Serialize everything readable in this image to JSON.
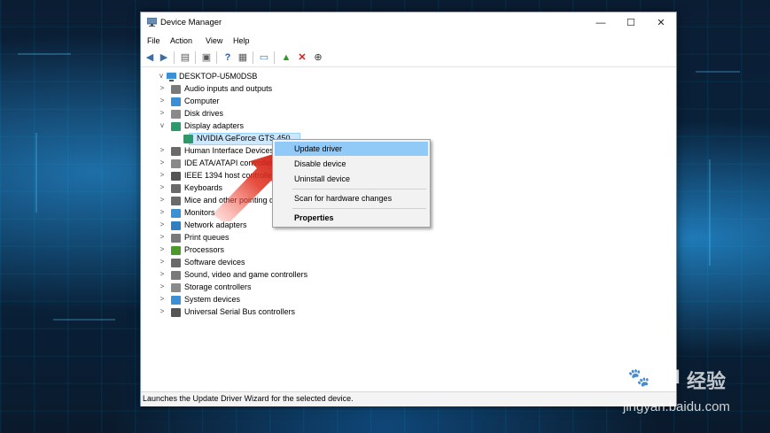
{
  "window": {
    "title": "Device Manager"
  },
  "window_buttons": [
    "—",
    "☐",
    "✕"
  ],
  "menubar": [
    "File",
    "Action",
    "View",
    "Help"
  ],
  "tree": {
    "root": "DESKTOP-U5M0DSB",
    "nodes": [
      {
        "label": "Audio inputs and outputs",
        "expand": ">",
        "icon_color": "#7a7a7a"
      },
      {
        "label": "Computer",
        "expand": ">",
        "icon_color": "#3b8fd4"
      },
      {
        "label": "Disk drives",
        "expand": ">",
        "icon_color": "#8a8a8a"
      },
      {
        "label": "Display adapters",
        "expand": "v",
        "icon_color": "#2c9a6a"
      },
      {
        "label": "NVIDIA GeForce GTS 450",
        "expand": "",
        "icon_color": "#2c9a6a",
        "selected": true,
        "child": true
      },
      {
        "label": "Human Interface Devices",
        "expand": ">",
        "icon_color": "#6a6a6a"
      },
      {
        "label": "IDE ATA/ATAPI controllers",
        "expand": ">",
        "icon_color": "#8a8a8a"
      },
      {
        "label": "IEEE 1394 host controllers",
        "expand": ">",
        "icon_color": "#555555"
      },
      {
        "label": "Keyboards",
        "expand": ">",
        "icon_color": "#6a6a6a"
      },
      {
        "label": "Mice and other pointing devices",
        "expand": ">",
        "icon_color": "#6a6a6a"
      },
      {
        "label": "Monitors",
        "expand": ">",
        "icon_color": "#3b8fd4"
      },
      {
        "label": "Network adapters",
        "expand": ">",
        "icon_color": "#2f7fc2"
      },
      {
        "label": "Print queues",
        "expand": ">",
        "icon_color": "#7a7a7a"
      },
      {
        "label": "Processors",
        "expand": ">",
        "icon_color": "#4c9a2a"
      },
      {
        "label": "Software devices",
        "expand": ">",
        "icon_color": "#6a6a6a"
      },
      {
        "label": "Sound, video and game controllers",
        "expand": ">",
        "icon_color": "#7a7a7a"
      },
      {
        "label": "Storage controllers",
        "expand": ">",
        "icon_color": "#8a8a8a"
      },
      {
        "label": "System devices",
        "expand": ">",
        "icon_color": "#3b8fd4"
      },
      {
        "label": "Universal Serial Bus controllers",
        "expand": ">",
        "icon_color": "#555555"
      }
    ]
  },
  "context_menu": {
    "update": "Update driver",
    "disable": "Disable device",
    "uninstall": "Uninstall device",
    "scan": "Scan for hardware changes",
    "properties": "Properties"
  },
  "status": "Launches the Update Driver Wizard for the selected device.",
  "watermark": {
    "logo": "Bai",
    "logo2": "du",
    "cn": "经验",
    "url": "jingyan.baidu.com"
  },
  "colors": {
    "accent": "#0078d7",
    "selection": "#cce8ff",
    "menu_highlight": "#91c9f7",
    "arrow": "#d8261c"
  }
}
